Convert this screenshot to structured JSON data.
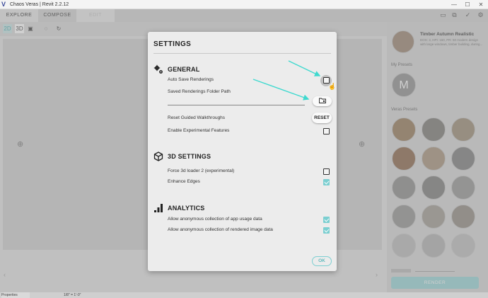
{
  "window": {
    "title": "Chaos Veras | Revit 2.2.12",
    "logo": "V"
  },
  "tabs": [
    {
      "label": "EXPLORE"
    },
    {
      "label": "COMPOSE"
    },
    {
      "label": "EDIT"
    }
  ],
  "toolbar": {
    "mode_2d": "2D",
    "mode_3d": "3D"
  },
  "right_panel": {
    "preset_title": "Timber Autumn Realistic",
    "preset_desc": "DOS: 3, HPI: 150, PR: 50 modern design with large windows, timber building, during...",
    "my_presets_label": "My Presets",
    "my_preset_initial": "M",
    "veras_presets_label": "Veras Presets",
    "render_label": "RENDER"
  },
  "status": {
    "scale": "1/8\" = 1'-0\"",
    "properties": "Properties"
  },
  "settings": {
    "title": "SETTINGS",
    "general": {
      "heading": "GENERAL",
      "auto_save_label": "Auto Save Renderings",
      "auto_save_checked": false,
      "folder_label": "Saved Renderings Folder Path",
      "reset_walkthroughs_label": "Reset Guided Walkthroughs",
      "reset_button": "RESET",
      "experimental_label": "Enable Experimental Features",
      "experimental_checked": false
    },
    "three_d": {
      "heading": "3D SETTINGS",
      "loader_label": "Force 3d loader 2 (experimental)",
      "loader_checked": false,
      "edges_label": "Enhance Edges",
      "edges_checked": true
    },
    "analytics": {
      "heading": "ANALYTICS",
      "usage_label": "Allow anonymous collection of app usage data",
      "usage_checked": true,
      "image_label": "Allow anonymous collection of rendered image data",
      "image_checked": true
    },
    "ok_label": "OK"
  },
  "colors": {
    "accent": "#7ccfd1",
    "annotation_arrow": "#3fd9cf"
  }
}
